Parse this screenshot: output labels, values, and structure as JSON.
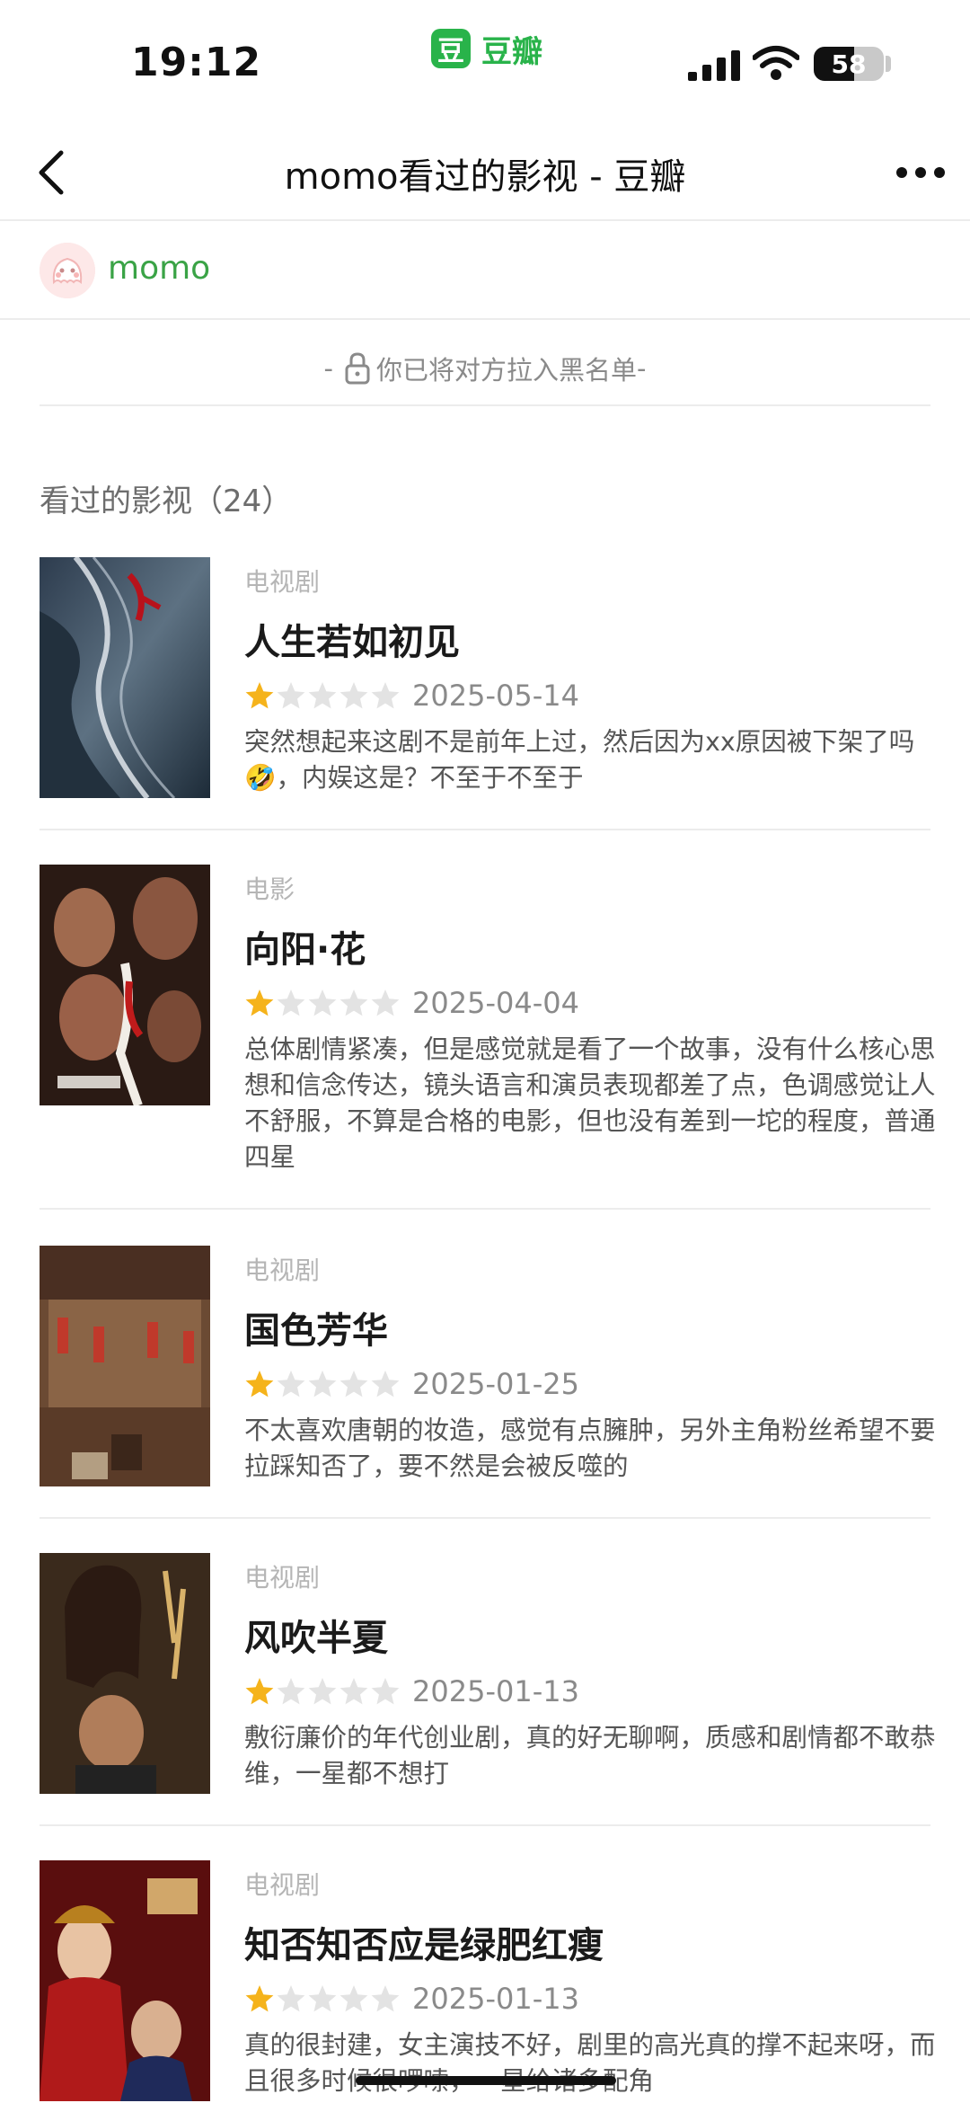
{
  "status_bar": {
    "time": "19:12",
    "app_name": "豆瓣",
    "app_logo_char": "豆",
    "battery_level": 58,
    "battery_text": "58",
    "icons": [
      "signal-icon",
      "wifi-icon",
      "battery-icon"
    ]
  },
  "nav": {
    "title": "momo看过的影视 - 豆瓣",
    "back_icon": "back-chevron-icon",
    "more_icon": "more-dots-icon"
  },
  "user": {
    "name": "momo",
    "avatar_icon": "avatar"
  },
  "blocked": {
    "prefix": "- ",
    "text": "你已将对方拉入黑名单",
    "suffix": " -"
  },
  "section": {
    "title": "看过的影视（24）"
  },
  "items": [
    {
      "type": "电视剧",
      "title": "人生若如初见",
      "rating": 1,
      "max_rating": 5,
      "date": "2025-05-14",
      "comment": "突然想起来这剧不是前年上过，然后因为xx原因被下架了吗🤣，内娱这是？不至于不至于"
    },
    {
      "type": "电影",
      "title": "向阳·花",
      "rating": 1,
      "max_rating": 5,
      "date": "2025-04-04",
      "comment": "总体剧情紧凑，但是感觉就是看了一个故事，没有什么核心思想和信念传达，镜头语言和演员表现都差了点，色调感觉让人不舒服，不算是合格的电影，但也没有差到一坨的程度，普通四星"
    },
    {
      "type": "电视剧",
      "title": "国色芳华",
      "rating": 1,
      "max_rating": 5,
      "date": "2025-01-25",
      "comment": "不太喜欢唐朝的妆造，感觉有点臃肿，另外主角粉丝希望不要拉踩知否了，要不然是会被反噬的"
    },
    {
      "type": "电视剧",
      "title": "风吹半夏",
      "rating": 1,
      "max_rating": 5,
      "date": "2025-01-13",
      "comment": "敷衍廉价的年代创业剧，真的好无聊啊，质感和剧情都不敢恭维，一星都不想打"
    },
    {
      "type": "电视剧",
      "title": "知否知否应是绿肥红瘦",
      "rating": 1,
      "max_rating": 5,
      "date": "2025-01-13",
      "comment": "真的很封建，女主演技不好，剧里的高光真的撑不起来呀，而且很多时候很啰嗦，一星给诸多配角"
    }
  ],
  "colors": {
    "brand_green": "#29b34a",
    "username_green": "#3aa346",
    "star_filled": "#f5b31b",
    "star_empty": "#e3e3e3",
    "divider": "#ececec"
  }
}
